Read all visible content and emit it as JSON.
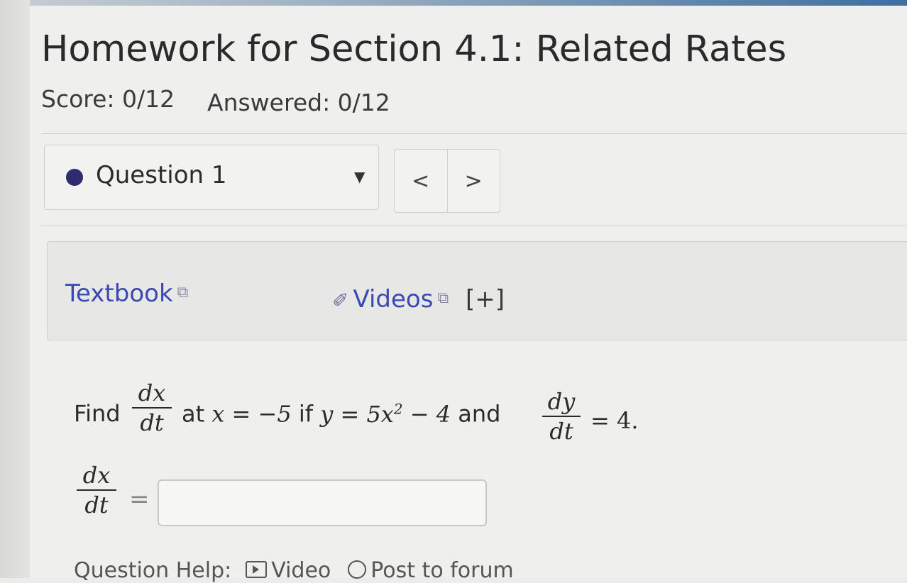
{
  "title": "Homework for Section 4.1: Related Rates",
  "score": "Score: 0/12",
  "answered": "Answered: 0/12",
  "question_select": {
    "label": "Question 1",
    "caret": "▼"
  },
  "nav": {
    "prev": "<",
    "next": ">"
  },
  "help_links": {
    "textbook": "Textbook",
    "videos": "Videos",
    "expand": "[+]"
  },
  "problem": {
    "find": "Find",
    "dx": "dx",
    "dt": "dt",
    "at": "at",
    "x_eq": "x = −5",
    "if": "if",
    "y_eq": "y = 5x",
    "exp": "2",
    "minus_four": " − 4",
    "and": "and",
    "dy": "dy",
    "eq_four": "= 4."
  },
  "answer": {
    "lhs_num": "dx",
    "lhs_den": "dt",
    "equals": "=",
    "value": ""
  },
  "question_help": {
    "label": "Question Help:",
    "video": "Video",
    "forum": "Post to forum"
  }
}
